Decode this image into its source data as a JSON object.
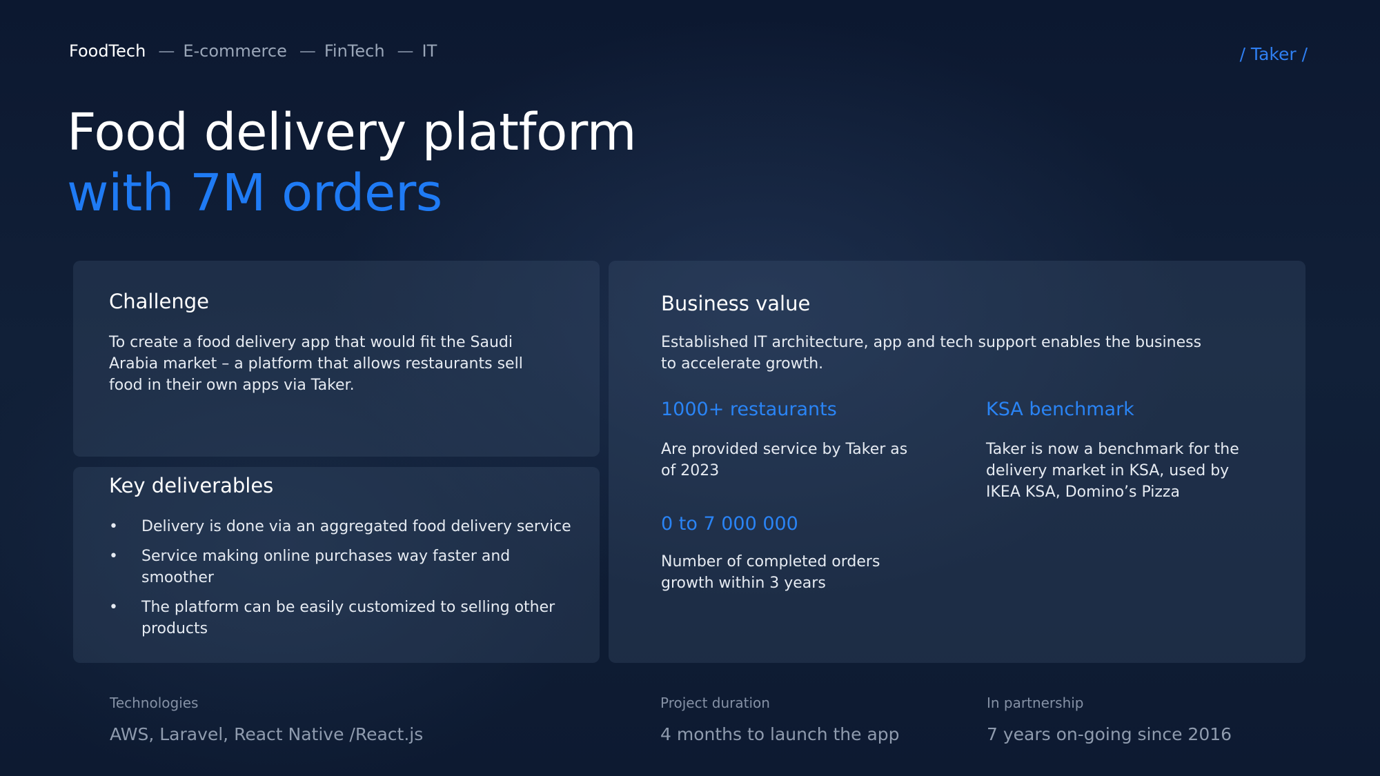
{
  "nav": {
    "items": [
      "FoodTech",
      "E-commerce",
      "FinTech",
      "IT"
    ],
    "separator": "—"
  },
  "brand_tag": "/ Taker /",
  "title": {
    "line1": "Food delivery platform",
    "line2": "with 7M orders"
  },
  "challenge": {
    "heading": "Challenge",
    "text": "To create a food delivery app that would fit the Saudi Arabia market – a platform that allows restaurants sell food in their own apps via Taker."
  },
  "deliverables": {
    "heading": "Key deliverables",
    "bullet": "•",
    "items": [
      "Delivery is done via an aggregated food delivery service",
      "Service making online purchases way faster and smoother",
      "The platform can be easily customized to selling other products"
    ]
  },
  "business": {
    "heading": "Business value",
    "text": "Established IT architecture, app and tech support enables the business to accelerate growth.",
    "metrics": [
      {
        "title": "1000+ restaurants",
        "desc": "Are provided service by Taker as of 2023"
      },
      {
        "title": "KSA benchmark",
        "desc": "Taker is now a benchmark for the delivery market in KSA, used by IKEA KSA, Domino’s Pizza"
      },
      {
        "title": "0 to 7 000 000",
        "desc": "Number of completed orders growth within 3 years"
      }
    ]
  },
  "footer": [
    {
      "label": "Technologies",
      "value": "AWS, Laravel, React Native /React.js"
    },
    {
      "label": "Project duration",
      "value": "4 months to launch the app"
    },
    {
      "label": "In partnership",
      "value": "7 years on-going since 2016"
    }
  ],
  "colors": {
    "accent": "#1f7bf5",
    "background": "#0f1d35"
  }
}
